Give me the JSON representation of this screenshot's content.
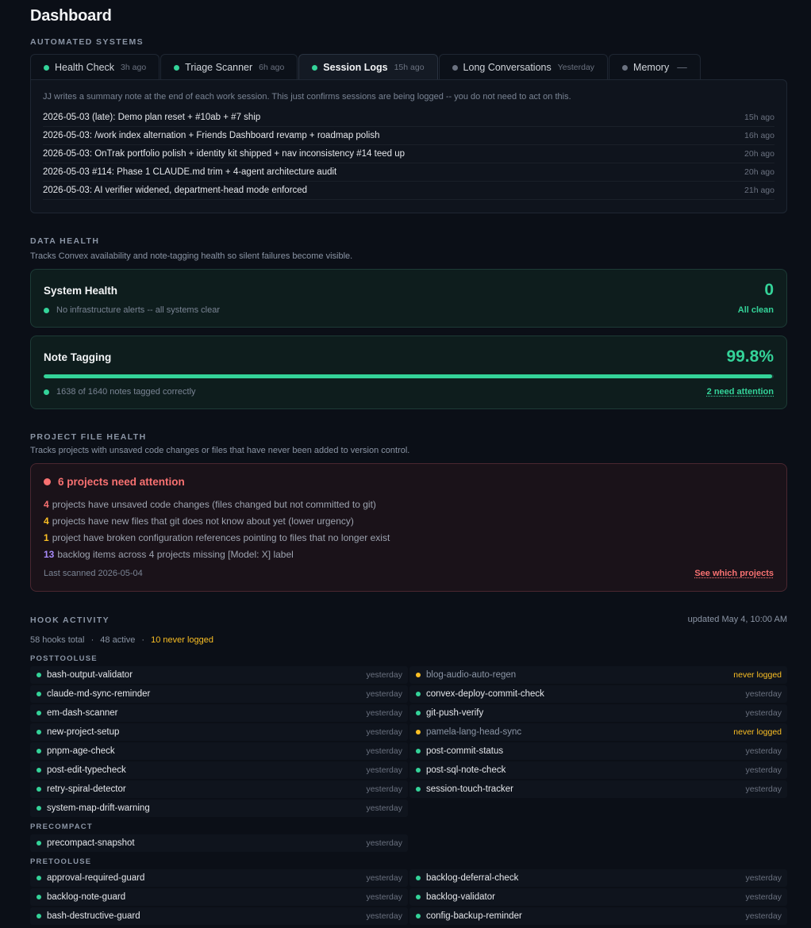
{
  "title": "Dashboard",
  "automated": {
    "label": "AUTOMATED SYSTEMS",
    "tabs": [
      {
        "name": "Health Check",
        "ago": "3h ago",
        "status": "green"
      },
      {
        "name": "Triage Scanner",
        "ago": "6h ago",
        "status": "green"
      },
      {
        "name": "Session Logs",
        "ago": "15h ago",
        "status": "green",
        "active": true
      },
      {
        "name": "Long Conversations",
        "ago": "Yesterday",
        "status": "gray"
      },
      {
        "name": "Memory",
        "ago": "—",
        "status": "gray"
      }
    ],
    "note": "JJ writes a summary note at the end of each work session. This just confirms sessions are being logged -- you do not need to act on this.",
    "logs": [
      {
        "text": "2026-05-03 (late): Demo plan reset + #10ab + #7 ship",
        "time": "15h ago"
      },
      {
        "text": "2026-05-03: /work index alternation + Friends Dashboard revamp + roadmap polish",
        "time": "16h ago"
      },
      {
        "text": "2026-05-03: OnTrak portfolio polish + identity kit shipped + nav inconsistency #14 teed up",
        "time": "20h ago"
      },
      {
        "text": "2026-05-03 #114: Phase 1 CLAUDE.md trim + 4-agent architecture audit",
        "time": "20h ago"
      },
      {
        "text": "2026-05-03: AI verifier widened, department-head mode enforced",
        "time": "21h ago"
      }
    ]
  },
  "data_health": {
    "label": "DATA HEALTH",
    "desc": "Tracks Convex availability and note-tagging health so silent failures become visible.",
    "system": {
      "title": "System Health",
      "count": "0",
      "sub": "No infrastructure alerts -- all systems clear",
      "status": "All clean"
    },
    "tagging": {
      "title": "Note Tagging",
      "percent": "99.8%",
      "fraction": 0.998,
      "sub": "1638 of 1640 notes tagged correctly",
      "link": "2 need attention"
    }
  },
  "project_health": {
    "label": "PROJECT FILE HEALTH",
    "desc": "Tracks projects with unsaved code changes or files that have never been added to version control.",
    "title": "6 projects need attention",
    "lines": [
      {
        "n": "4",
        "text": "projects have unsaved code changes (files changed but not committed to git)",
        "color": "#f87171"
      },
      {
        "n": "4",
        "text": "projects have new files that git does not know about yet (lower urgency)",
        "color": "#fbbf24"
      },
      {
        "n": "1",
        "text": "project have broken configuration references pointing to files that no longer exist",
        "color": "#fbbf24"
      },
      {
        "n": "13",
        "text": "backlog items across 4 projects missing [Model: X] label",
        "color": "#a78bfa"
      }
    ],
    "scanned": "Last scanned 2026-05-04",
    "link": "See which projects"
  },
  "hooks": {
    "label": "HOOK ACTIVITY",
    "updated": "updated May 4, 10:00 AM",
    "total": "58 hooks total",
    "active": "48 active",
    "never": "10 never logged",
    "sep": "·",
    "groups": [
      {
        "name": "POSTTOOLUSE",
        "items": [
          {
            "name": "bash-output-validator",
            "when": "yesterday"
          },
          {
            "name": "blog-audio-auto-regen",
            "when": "never logged",
            "never": true
          },
          {
            "name": "claude-md-sync-reminder",
            "when": "yesterday"
          },
          {
            "name": "convex-deploy-commit-check",
            "when": "yesterday"
          },
          {
            "name": "em-dash-scanner",
            "when": "yesterday"
          },
          {
            "name": "git-push-verify",
            "when": "yesterday"
          },
          {
            "name": "new-project-setup",
            "when": "yesterday"
          },
          {
            "name": "pamela-lang-head-sync",
            "when": "never logged",
            "never": true
          },
          {
            "name": "pnpm-age-check",
            "when": "yesterday"
          },
          {
            "name": "post-commit-status",
            "when": "yesterday"
          },
          {
            "name": "post-edit-typecheck",
            "when": "yesterday"
          },
          {
            "name": "post-sql-note-check",
            "when": "yesterday"
          },
          {
            "name": "retry-spiral-detector",
            "when": "yesterday"
          },
          {
            "name": "session-touch-tracker",
            "when": "yesterday"
          },
          {
            "name": "system-map-drift-warning",
            "when": "yesterday"
          }
        ]
      },
      {
        "name": "PRECOMPACT",
        "items": [
          {
            "name": "precompact-snapshot",
            "when": "yesterday"
          }
        ]
      },
      {
        "name": "PRETOOLUSE",
        "items": [
          {
            "name": "approval-required-guard",
            "when": "yesterday"
          },
          {
            "name": "backlog-deferral-check",
            "when": "yesterday"
          },
          {
            "name": "backlog-note-guard",
            "when": "yesterday"
          },
          {
            "name": "backlog-validator",
            "when": "yesterday"
          },
          {
            "name": "bash-destructive-guard",
            "when": "yesterday"
          },
          {
            "name": "config-backup-reminder",
            "when": "yesterday"
          }
        ]
      }
    ]
  },
  "colors": {
    "green": "#34d399",
    "gray": "#6b7280",
    "red": "#f87171",
    "amber": "#fbbf24",
    "purple": "#a78bfa"
  }
}
